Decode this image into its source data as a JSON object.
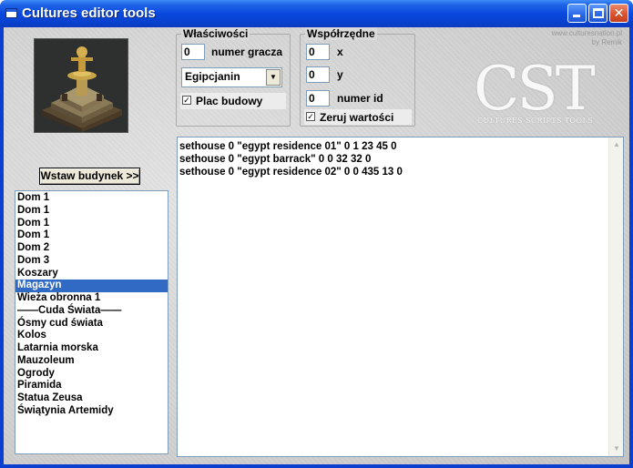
{
  "window": {
    "title": "Cultures editor tools"
  },
  "watermark": {
    "line1": "www.culturesnation.pl",
    "line2": "by Remik"
  },
  "logo": {
    "main": "CST",
    "sub": "CULTURES SCRIPTS TOOLS"
  },
  "properties": {
    "group_label": "Właściwości",
    "player_number_value": "0",
    "player_number_label": "numer gracza",
    "civilization_selected": "Egipcjanin",
    "construction_site_label": "Plac budowy",
    "construction_site_checked": true
  },
  "coordinates": {
    "group_label": "Współrzędne",
    "x_value": "0",
    "x_label": "x",
    "y_value": "0",
    "y_label": "y",
    "id_value": "0",
    "id_label": "numer id",
    "reset_label": "Zeruj wartości",
    "reset_checked": true
  },
  "insert_button": "Wstaw budynek >>",
  "buildings": {
    "selected_index": 7,
    "items": [
      "Dom 1",
      "Dom 1",
      "Dom 1",
      "Dom 1",
      "Dom 2",
      "Dom 3",
      "Koszary",
      "Magazyn",
      "Wieża obronna 1",
      "——Cuda Świata——",
      "Ósmy cud świata",
      "Kolos",
      "Latarnia morska",
      "Mauzoleum",
      "Ogrody",
      "Piramida",
      "Statua Zeusa",
      "Świątynia Artemidy"
    ]
  },
  "script": {
    "lines": [
      "sethouse 0 \"egypt residence 01\" 0 1 23 45 0",
      "sethouse 0 \"egypt barrack\" 0 0 32 32 0",
      "sethouse 0 \"egypt residence 02\" 0 0 435 13 0"
    ]
  },
  "icons": {
    "minimize": "minimize-icon",
    "maximize": "maximize-icon",
    "close": "close-icon",
    "dropdown": "chevron-down-icon",
    "app": "window-icon"
  }
}
